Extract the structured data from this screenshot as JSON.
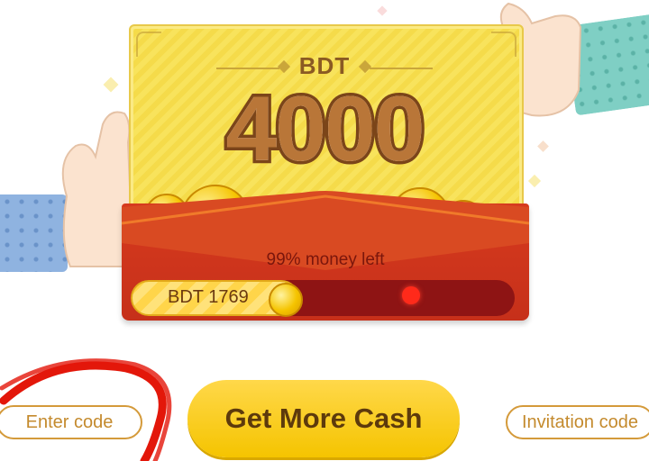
{
  "card": {
    "currency": "BDT",
    "amount": "4000",
    "money_left_text": "99% money left"
  },
  "progress": {
    "label": "BDT 1769",
    "fill_fraction": 0.44
  },
  "buttons": {
    "enter_code": "Enter code",
    "get_more_cash": "Get More Cash",
    "invitation_code": "Invitation code"
  },
  "colors": {
    "card_yellow": "#f8e35c",
    "envelope_red": "#d63a1e",
    "cash_button": "#ffd84a",
    "outline_gold": "#d49a3a",
    "scribble_red": "#e3170a"
  }
}
